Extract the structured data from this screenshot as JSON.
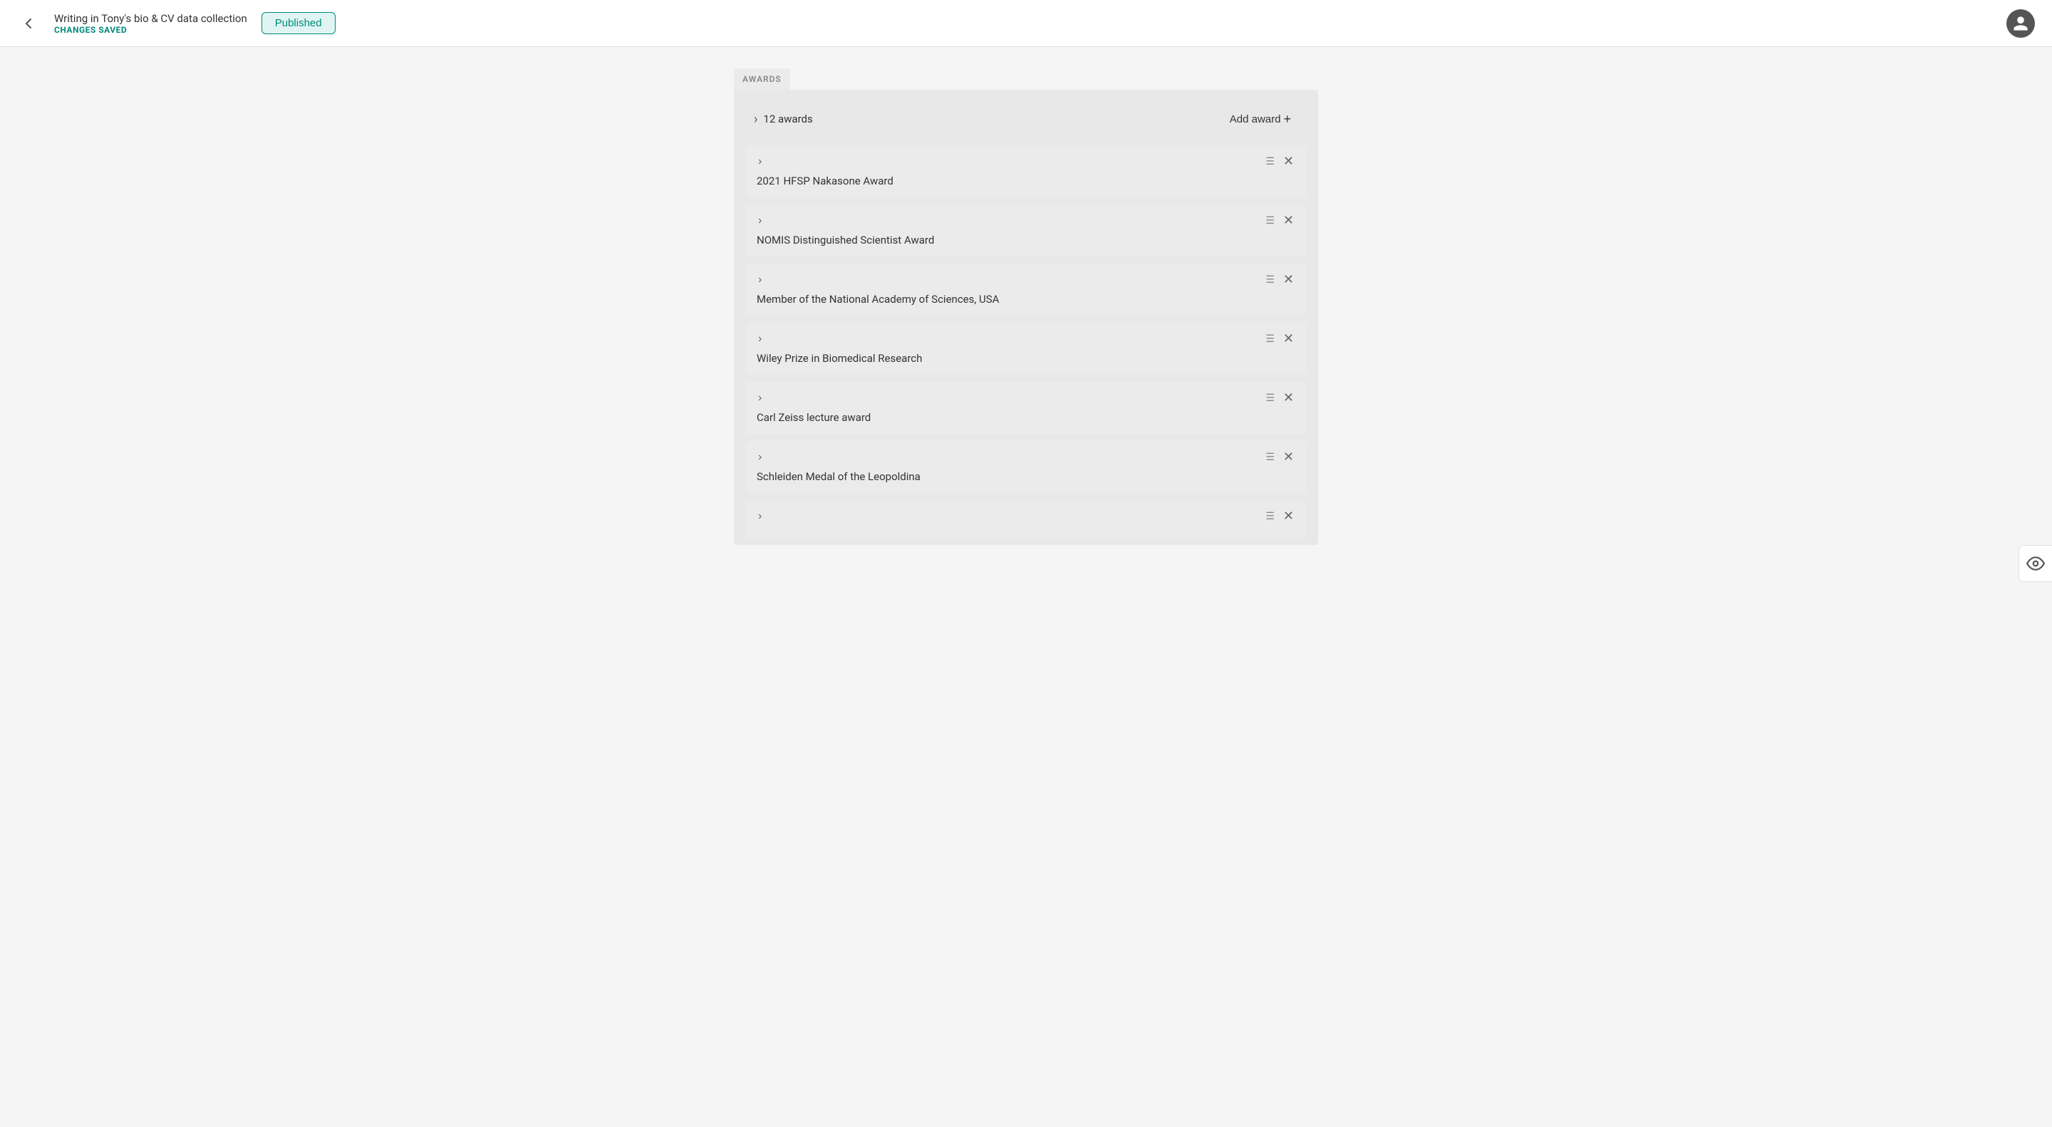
{
  "header": {
    "back_label": "back",
    "title": "Writing in Tony's bio & CV data collection",
    "changes_saved": "CHANGES SAVED",
    "published_label": "Published"
  },
  "sidebar": {
    "preview_icon": "eye-icon"
  },
  "awards_section": {
    "section_label": "AWARDS",
    "summary": {
      "count_text": "12 awards",
      "add_button_label": "Add award",
      "add_icon": "plus-icon"
    },
    "items": [
      {
        "name": "2021 HFSP Nakasone Award"
      },
      {
        "name": "NOMIS Distinguished Scientist Award"
      },
      {
        "name": "Member of the National Academy of Sciences, USA"
      },
      {
        "name": "Wiley Prize in Biomedical Research"
      },
      {
        "name": "Carl Zeiss lecture award"
      },
      {
        "name": "Schleiden Medal of the Leopoldina"
      },
      {
        "name": ""
      }
    ]
  }
}
